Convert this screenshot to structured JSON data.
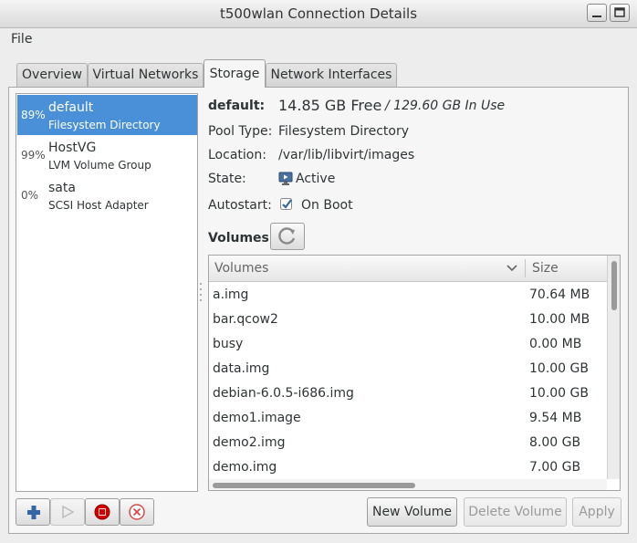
{
  "window": {
    "title": "t500wlan Connection Details"
  },
  "menu": {
    "file": "File"
  },
  "tabs": [
    {
      "label": "Overview"
    },
    {
      "label": "Virtual Networks"
    },
    {
      "label": "Storage"
    },
    {
      "label": "Network Interfaces"
    }
  ],
  "active_tab": "Storage",
  "pools": [
    {
      "percent": "89%",
      "name": "default",
      "type": "Filesystem Directory",
      "selected": true
    },
    {
      "percent": "99%",
      "name": "HostVG",
      "type": "LVM Volume Group"
    },
    {
      "percent": "0%",
      "name": "sata",
      "type": "SCSI Host Adapter"
    }
  ],
  "details": {
    "name": "default:",
    "free": "14.85 GB Free",
    "in_use": " / 129.60 GB In Use",
    "pool_type_label": "Pool Type:",
    "pool_type": "Filesystem Directory",
    "location_label": "Location:",
    "location": "/var/lib/libvirt/images",
    "state_label": "State:",
    "state": "Active",
    "autostart_label": "Autostart:",
    "autostart": "On Boot",
    "autostart_checked": true,
    "volumes_label": "Volumes"
  },
  "volume_table": {
    "columns": [
      "Volumes",
      "Size"
    ],
    "rows": [
      {
        "name": "a.img",
        "size": "70.64 MB"
      },
      {
        "name": "bar.qcow2",
        "size": "10.00 MB"
      },
      {
        "name": "busy",
        "size": "0.00 MB"
      },
      {
        "name": "data.img",
        "size": "10.00 GB"
      },
      {
        "name": "debian-6.0.5-i686.img",
        "size": "10.00 GB"
      },
      {
        "name": "demo1.image",
        "size": "9.54 MB"
      },
      {
        "name": "demo2.img",
        "size": "8.00 GB"
      },
      {
        "name": "demo.img",
        "size": "7.00 GB"
      }
    ]
  },
  "buttons": {
    "new_volume": "New Volume",
    "delete_volume": "Delete Volume",
    "apply": "Apply"
  },
  "colors": {
    "selection": "#4a90d9",
    "stop_red": "#d40000",
    "add_blue": "#3465a4"
  }
}
